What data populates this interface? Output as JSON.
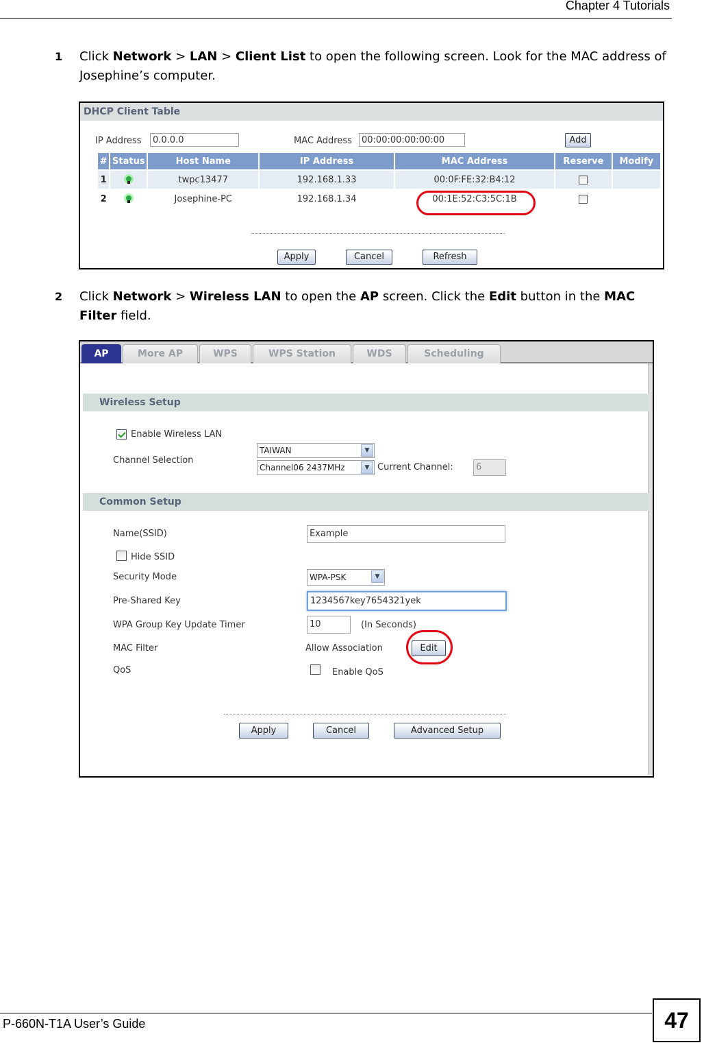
{
  "header": {
    "chapter": "Chapter 4 Tutorials"
  },
  "footer": {
    "guide_title": "P-660N-T1A User’s Guide",
    "page_number": "47"
  },
  "steps": [
    {
      "number": "1",
      "parts": [
        "Click ",
        "Network",
        " > ",
        "LAN",
        " > ",
        "Client List",
        " to open the following screen. Look for the MAC address of Josephine’s computer."
      ]
    },
    {
      "number": "2",
      "parts": [
        "Click ",
        "Network",
        " > ",
        "Wireless LAN",
        " to open the ",
        "AP",
        " screen. Click the ",
        "Edit",
        " button in the ",
        "MAC Filter",
        " field."
      ]
    }
  ],
  "dhcp": {
    "title": "DHCP Client Table",
    "ip_label": "IP Address",
    "ip_value": "0.0.0.0",
    "mac_label": "MAC Address",
    "mac_value": "00:00:00:00:00:00",
    "add_label": "Add",
    "columns": [
      "#",
      "Status",
      "Host Name",
      "IP Address",
      "MAC Address",
      "Reserve",
      "Modify"
    ],
    "rows": [
      {
        "num": "1",
        "status": "online-bulb-icon",
        "host": "twpc13477",
        "ip": "192.168.1.33",
        "mac": "00:0F:FE:32:B4:12",
        "reserve": false,
        "modify": ""
      },
      {
        "num": "2",
        "status": "online-bulb-icon",
        "host": "Josephine-PC",
        "ip": "192.168.1.34",
        "mac": "00:1E:52:C3:5C:1B",
        "reserve": false,
        "modify": ""
      }
    ],
    "highlighted_mac": "00:1E:52:C3:5C:1B",
    "buttons": {
      "apply": "Apply",
      "cancel": "Cancel",
      "refresh": "Refresh"
    }
  },
  "ap": {
    "tabs": [
      {
        "label": "AP",
        "active": true
      },
      {
        "label": "More AP",
        "active": false
      },
      {
        "label": "WPS",
        "active": false
      },
      {
        "label": "WPS Station",
        "active": false
      },
      {
        "label": "WDS",
        "active": false
      },
      {
        "label": "Scheduling",
        "active": false
      }
    ],
    "wireless_setup": {
      "title": "Wireless Setup",
      "enable_wlan_label": "Enable Wireless LAN",
      "enable_wlan_checked": true,
      "channel_label": "Channel Selection",
      "country_value": "TAIWAN",
      "channel_value": "Channel06 2437MHz",
      "current_channel_label": "Current Channel:",
      "current_channel_value": "6"
    },
    "common_setup": {
      "title": "Common Setup",
      "ssid_label": "Name(SSID)",
      "ssid_value": "Example",
      "hide_ssid_label": "Hide SSID",
      "hide_ssid_checked": false,
      "security_label": "Security Mode",
      "security_value": "WPA-PSK",
      "psk_label": "Pre-Shared Key",
      "psk_value": "1234567key7654321yek",
      "timer_label": "WPA Group Key Update Timer",
      "timer_value": "10",
      "timer_unit": "(In Seconds)",
      "mac_filter_label": "MAC Filter",
      "mac_filter_value": "Allow Association",
      "edit_label": "Edit",
      "qos_label": "QoS",
      "qos_checkbox_label": "Enable QoS",
      "qos_checked": false
    },
    "buttons": {
      "apply": "Apply",
      "cancel": "Cancel",
      "advanced": "Advanced Setup"
    }
  },
  "colors": {
    "highlight_ring": "#e30613",
    "table_header": "#7d9ccc",
    "active_tab": "#2c3490",
    "section_bar": "#d4dfdc"
  }
}
